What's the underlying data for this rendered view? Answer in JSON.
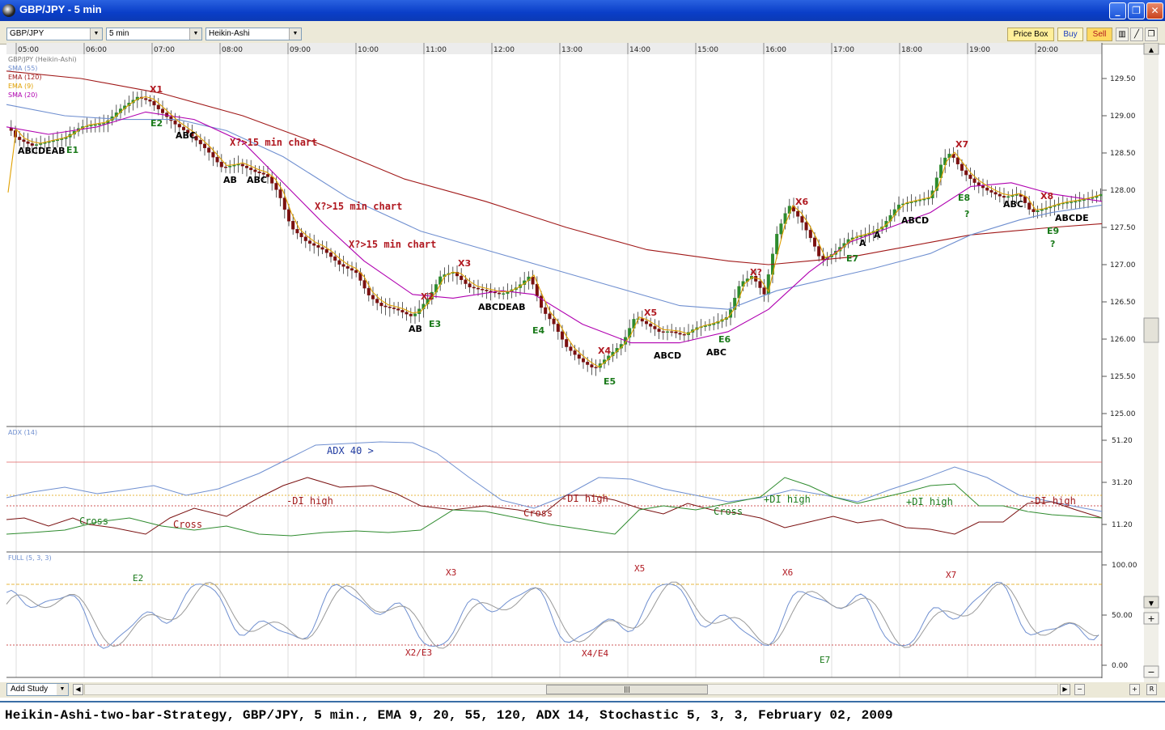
{
  "window": {
    "title": "GBP/JPY - 5 min"
  },
  "toolbar": {
    "symbol": "GBP/JPY",
    "interval": "5 min",
    "chart_type": "Heikin-Ashi",
    "price_box": "Price Box",
    "buy": "Buy",
    "sell": "Sell"
  },
  "legend": {
    "instrument": "GBP/JPY (Heikin-Ashi)",
    "items": [
      {
        "label": "SMA (55)",
        "color": "#6f8fd0"
      },
      {
        "label": "EMA (120)",
        "color": "#a01818"
      },
      {
        "label": "EMA (9)",
        "color": "#e0a000"
      },
      {
        "label": "SMA (20)",
        "color": "#b000b0"
      }
    ]
  },
  "time_axis": [
    "05:00",
    "06:00",
    "07:00",
    "08:00",
    "09:00",
    "10:00",
    "11:00",
    "12:00",
    "13:00",
    "14:00",
    "15:00",
    "16:00",
    "17:00",
    "18:00",
    "19:00",
    "20:00"
  ],
  "price_axis": [
    "129.50",
    "129.00",
    "128.50",
    "128.00",
    "127.50",
    "127.00",
    "126.50",
    "126.00",
    "125.50",
    "125.00"
  ],
  "adx_panel": {
    "title": "ADX (14)",
    "axis": [
      "51.20",
      "31.20",
      "11.20"
    ]
  },
  "stoch_panel": {
    "title": "FULL (5, 3, 3)",
    "axis": [
      "100.00",
      "50.00",
      "0.00"
    ]
  },
  "annotations": {
    "price": [
      {
        "text": "X1",
        "color": "#b01820"
      },
      {
        "text": "E2",
        "color": "#1a7a1a"
      },
      {
        "text": "ABCDEAB",
        "color": "#000000"
      },
      {
        "text": "E1",
        "color": "#1a7a1a"
      },
      {
        "text": "ABC",
        "color": "#000000"
      },
      {
        "text": "X?>15 min chart",
        "color": "#b01820"
      },
      {
        "text": "AB",
        "color": "#000000"
      },
      {
        "text": "ABC",
        "color": "#000000"
      },
      {
        "text": "X?>15 min chart",
        "color": "#b01820"
      },
      {
        "text": "X?>15 min chart",
        "color": "#b01820"
      },
      {
        "text": "X3",
        "color": "#b01820"
      },
      {
        "text": "X2",
        "color": "#b01820"
      },
      {
        "text": "ABCDEAB",
        "color": "#000000"
      },
      {
        "text": "AB",
        "color": "#000000"
      },
      {
        "text": "E3",
        "color": "#1a7a1a"
      },
      {
        "text": "E4",
        "color": "#1a7a1a"
      },
      {
        "text": "X4",
        "color": "#b01820"
      },
      {
        "text": "E5",
        "color": "#1a7a1a"
      },
      {
        "text": "X5",
        "color": "#b01820"
      },
      {
        "text": "ABCD",
        "color": "#000000"
      },
      {
        "text": "E6",
        "color": "#1a7a1a"
      },
      {
        "text": "ABC",
        "color": "#000000"
      },
      {
        "text": "X?",
        "color": "#b01820"
      },
      {
        "text": "X6",
        "color": "#b01820"
      },
      {
        "text": "E7",
        "color": "#1a7a1a"
      },
      {
        "text": "A",
        "color": "#000000"
      },
      {
        "text": "A",
        "color": "#000000"
      },
      {
        "text": "ABCD",
        "color": "#000000"
      },
      {
        "text": "X7",
        "color": "#b01820"
      },
      {
        "text": "E8",
        "color": "#1a7a1a"
      },
      {
        "text": "?",
        "color": "#1a7a1a"
      },
      {
        "text": "ABC",
        "color": "#000000"
      },
      {
        "text": "X8",
        "color": "#b01820"
      },
      {
        "text": "ABCDE",
        "color": "#000000"
      },
      {
        "text": "E9",
        "color": "#1a7a1a"
      },
      {
        "text": "?",
        "color": "#1a7a1a"
      }
    ],
    "adx": [
      {
        "text": "ADX 40 >",
        "color": "#1f3aa0"
      },
      {
        "text": "-DI high",
        "color": "#a01818"
      },
      {
        "text": "Cross",
        "color": "#1a7a1a"
      },
      {
        "text": "Cross",
        "color": "#a01818"
      },
      {
        "text": "-DI high",
        "color": "#a01818"
      },
      {
        "text": "Cross",
        "color": "#a01818"
      },
      {
        "text": "Cross",
        "color": "#1a7a1a"
      },
      {
        "text": "+DI high",
        "color": "#1a7a1a"
      },
      {
        "text": "+DI high",
        "color": "#1a7a1a"
      },
      {
        "text": "-DI high",
        "color": "#a01818"
      }
    ],
    "stoch": [
      {
        "text": "E2",
        "color": "#1a7a1a"
      },
      {
        "text": "X3",
        "color": "#b01820"
      },
      {
        "text": "X2/E3",
        "color": "#b01820"
      },
      {
        "text": "X5",
        "color": "#b01820"
      },
      {
        "text": "X4/E4",
        "color": "#b01820"
      },
      {
        "text": "X6",
        "color": "#b01820"
      },
      {
        "text": "E7",
        "color": "#1a7a1a"
      },
      {
        "text": "X7",
        "color": "#b01820"
      }
    ]
  },
  "bottom": {
    "add_study": "Add Study"
  },
  "caption": "Heikin-Ashi-two-bar-Strategy, GBP/JPY, 5 min., EMA 9, 20, 55, 120, ADX 14, Stochastic 5, 3, 3, February 02, 2009"
}
